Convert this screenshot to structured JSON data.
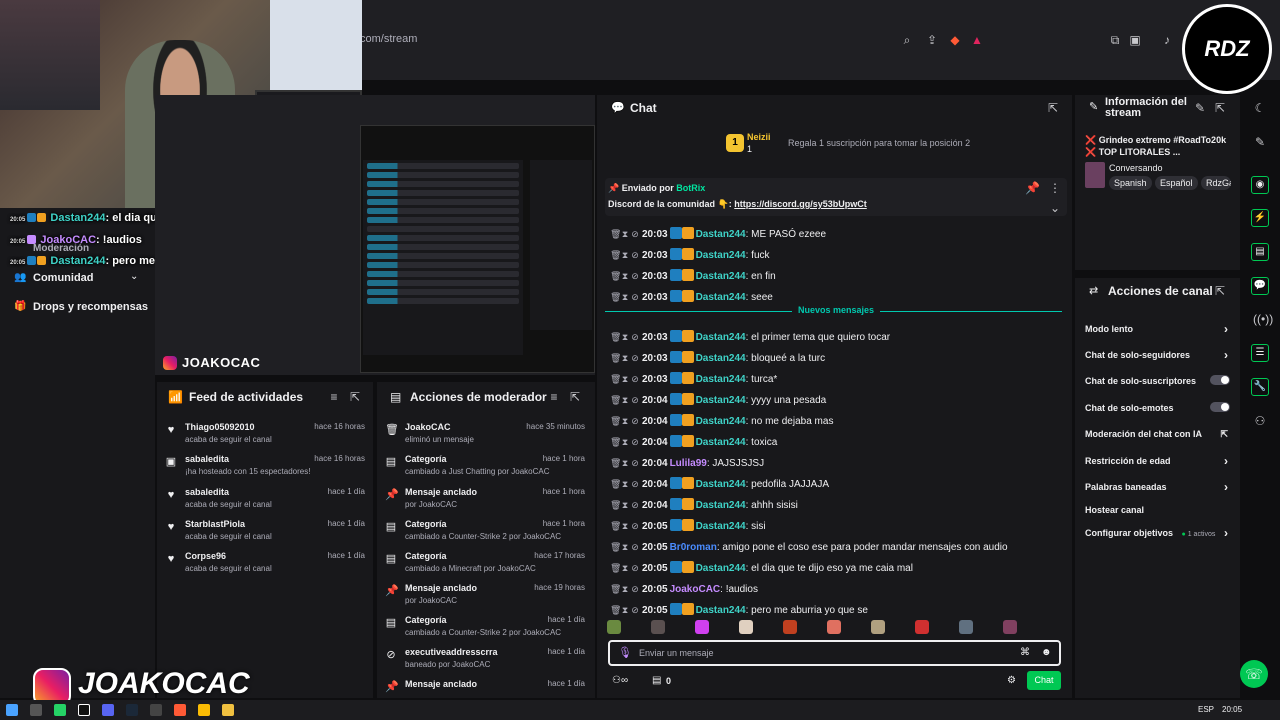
{
  "browser": {
    "url": "com/stream"
  },
  "overlay": {
    "lines": [
      {
        "time": "20:05",
        "user": "Dastan244",
        "text": "el dia que te dijo eso ya me caia mal"
      },
      {
        "time": "20:05",
        "user": "JoakoCAC",
        "text": "!audios"
      },
      {
        "time": "20:05",
        "user": "Dastan244",
        "text": "pero me aburria yo que se"
      }
    ],
    "watermark": "JOAKOCAC",
    "logo_text": "RDZ"
  },
  "leftnav": {
    "items": [
      {
        "label": "Moderación"
      },
      {
        "label": "Comunidad"
      },
      {
        "label": "Drops y recompensas"
      }
    ]
  },
  "preview": {
    "tag": "JOAKOCAC"
  },
  "feed": {
    "title": "Feed de actividades",
    "items": [
      {
        "name": "Thiago05092010",
        "sub": "acaba de seguir el canal",
        "time": "hace 16 horas",
        "icon": "heart-icon"
      },
      {
        "name": "sabaledita",
        "sub": "¡ha hosteado con 15 espectadores!",
        "time": "hace 16 horas",
        "icon": "host-icon"
      },
      {
        "name": "sabaledita",
        "sub": "acaba de seguir el canal",
        "time": "hace 1 día",
        "icon": "heart-icon"
      },
      {
        "name": "StarblastPiola",
        "sub": "acaba de seguir el canal",
        "time": "hace 1 día",
        "icon": "heart-icon"
      },
      {
        "name": "Corpse96",
        "sub": "acaba de seguir el canal",
        "time": "hace 1 día",
        "icon": "heart-icon"
      }
    ]
  },
  "mod": {
    "title": "Acciones de moderador",
    "items": [
      {
        "name": "JoakoCAC",
        "sub": "eliminó un mensaje",
        "time": "hace 35 minutos",
        "icon": "trash-icon"
      },
      {
        "name": "Categoría",
        "sub": "cambiado a Just Chatting por JoakoCAC",
        "time": "hace 1 hora",
        "icon": "category-icon"
      },
      {
        "name": "Mensaje anclado",
        "sub": "por JoakoCAC",
        "time": "hace 1 hora",
        "icon": "pin-icon"
      },
      {
        "name": "Categoría",
        "sub": "cambiado a Counter-Strike 2 por JoakoCAC",
        "time": "hace 1 hora",
        "icon": "category-icon"
      },
      {
        "name": "Categoría",
        "sub": "cambiado a Minecraft por JoakoCAC",
        "time": "hace 17 horas",
        "icon": "category-icon"
      },
      {
        "name": "Mensaje anclado",
        "sub": "por JoakoCAC",
        "time": "hace 19 horas",
        "icon": "pin-icon"
      },
      {
        "name": "Categoría",
        "sub": "cambiado a Counter-Strike 2 por JoakoCAC",
        "time": "hace 1 día",
        "icon": "category-icon"
      },
      {
        "name": "executiveaddresscrra",
        "sub": "baneado por JoakoCAC",
        "time": "hace 1 día",
        "icon": "ban-icon"
      },
      {
        "name": "Mensaje anclado",
        "sub": "",
        "time": "hace 1 día",
        "icon": "pin-icon"
      }
    ]
  },
  "chat": {
    "title": "Chat",
    "top_gifter": {
      "name": "Neizii",
      "count": "1",
      "text": "Regala 1 suscripción para tomar la posición 2"
    },
    "pinned": {
      "by_label": "Enviado por",
      "by": "BotRix",
      "text": "Discord de la comunidad 👇:",
      "link": "https://discord.gg/sy53bUpwCt"
    },
    "new_messages": "Nuevos mensajes",
    "messages": [
      {
        "time": "20:03",
        "user": "Dastan244",
        "text": "ME PASÓ ezeee",
        "cls": "u-dastan"
      },
      {
        "time": "20:03",
        "user": "Dastan244",
        "text": "fuck",
        "cls": "u-dastan"
      },
      {
        "time": "20:03",
        "user": "Dastan244",
        "text": "en fin",
        "cls": "u-dastan"
      },
      {
        "time": "20:03",
        "user": "Dastan244",
        "text": "seee",
        "cls": "u-dastan"
      },
      {
        "time": "20:03",
        "user": "Dastan244",
        "text": "el primer tema que quiero tocar",
        "cls": "u-dastan"
      },
      {
        "time": "20:03",
        "user": "Dastan244",
        "text": "bloqueé a la turc",
        "cls": "u-dastan"
      },
      {
        "time": "20:03",
        "user": "Dastan244",
        "text": "turca*",
        "cls": "u-dastan"
      },
      {
        "time": "20:04",
        "user": "Dastan244",
        "text": "yyyy una pesada",
        "cls": "u-dastan"
      },
      {
        "time": "20:04",
        "user": "Dastan244",
        "text": "no me dejaba mas",
        "cls": "u-dastan"
      },
      {
        "time": "20:04",
        "user": "Dastan244",
        "text": "toxica",
        "cls": "u-dastan"
      },
      {
        "time": "20:04",
        "user": "Lulila99",
        "text": "JAJSJSJSJ",
        "cls": "u-lulia"
      },
      {
        "time": "20:04",
        "user": "Dastan244",
        "text": "pedofila JAJJAJA",
        "cls": "u-dastan"
      },
      {
        "time": "20:04",
        "user": "Dastan244",
        "text": "ahhh sisisi",
        "cls": "u-dastan"
      },
      {
        "time": "20:05",
        "user": "Dastan244",
        "text": "sisi",
        "cls": "u-dastan"
      },
      {
        "time": "20:05",
        "user": "Br0roman",
        "text": "amigo pone el coso ese para poder mandar mensajes con audio",
        "cls": "u-broroman"
      },
      {
        "time": "20:05",
        "user": "Dastan244",
        "text": "el dia que te dijo eso ya me caia mal",
        "cls": "u-dastan"
      },
      {
        "time": "20:05",
        "user": "JoakoCAC",
        "text": "!audios",
        "cls": "u-joako"
      },
      {
        "time": "20:05",
        "user": "Dastan244",
        "text": "pero me aburria yo que se",
        "cls": "u-dastan"
      }
    ],
    "input_placeholder": "Enviar un mensaje",
    "viewers": "0",
    "send_label": "Chat"
  },
  "stream_info": {
    "title": "Información del stream",
    "stream_title": "❌ Grindeo extremo #RoadTo20k ❌ TOP LITORALES ...",
    "category": "Conversando",
    "tags": [
      "Spanish",
      "Español",
      "RdzGa"
    ]
  },
  "channel_actions": {
    "title": "Acciones de canal",
    "items": [
      {
        "label": "Modo lento",
        "control": "chevron"
      },
      {
        "label": "Chat de solo-seguidores",
        "control": "chevron"
      },
      {
        "label": "Chat de solo-suscriptores",
        "control": "toggle"
      },
      {
        "label": "Chat de solo-emotes",
        "control": "toggle"
      },
      {
        "label": "Moderación del chat con IA",
        "control": "external"
      },
      {
        "label": "Restricción de edad",
        "control": "chevron"
      },
      {
        "label": "Palabras baneadas",
        "control": "chevron"
      },
      {
        "label": "Hostear canal",
        "control": "none"
      },
      {
        "label": "Configurar objetivos",
        "control": "chevron",
        "badge": "1 activos"
      }
    ]
  },
  "taskbar": {
    "lang": "ESP",
    "clock": "20:05"
  }
}
